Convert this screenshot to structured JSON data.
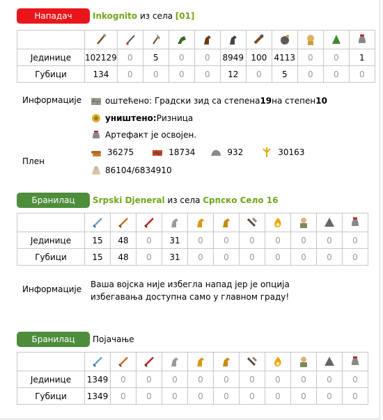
{
  "attacker": {
    "role": "Нападач",
    "player": "Inkognito",
    "from_text": "из села",
    "village": "[01]",
    "units_label": "Јединице",
    "losses_label": "Губици",
    "units": [
      "102129",
      "0",
      "5",
      "0",
      "0",
      "8949",
      "100",
      "4113",
      "0",
      "0",
      "1"
    ],
    "losses": [
      "134",
      "0",
      "0",
      "0",
      "0",
      "12",
      "0",
      "5",
      "0",
      "0",
      "0"
    ],
    "icons": [
      "spear-fighter-icon",
      "swordsman-icon",
      "axeman-icon",
      "scout-icon",
      "light-cavalry-icon",
      "heavy-cavalry-icon",
      "ram-icon",
      "catapult-icon",
      "knight-icon",
      "nobleman-icon",
      "militia-icon"
    ]
  },
  "info": {
    "label": "Информације",
    "line1_prefix": "оштећено: Градски зид са степена ",
    "line1_from": "19",
    "line1_mid": " на степен ",
    "line1_to": "10",
    "line2_bold": "уништено:",
    "line2_rest": " Ризница",
    "line3": "Артефакт је освојен.",
    "icons": [
      "wall-icon",
      "treasury-icon",
      "artifact-icon"
    ]
  },
  "loot": {
    "label": "Плен",
    "wood": "36275",
    "clay": "18734",
    "iron": "932",
    "crop": "30163",
    "carry": "86104/6834910"
  },
  "defender1": {
    "role": "Бранилац",
    "player": "Srpski Djeneral",
    "from_text": "из села",
    "village": "Српско Село 16",
    "units_label": "Јединице",
    "losses_label": "Губици",
    "units": [
      "15",
      "48",
      "0",
      "31",
      "0",
      "0",
      "0",
      "0",
      "0",
      "0",
      "0"
    ],
    "losses": [
      "15",
      "48",
      "0",
      "31",
      "0",
      "0",
      "0",
      "0",
      "0",
      "0",
      "0"
    ],
    "info_label": "Информације",
    "info_text": "Ваша војска није избегла напад јер је опција избегавања доступна само у главном граду!"
  },
  "defender2": {
    "role": "Бранилац",
    "title": "Појачање",
    "units_label": "Јединице",
    "losses_label": "Губици",
    "units": [
      "1349",
      "0",
      "0",
      "0",
      "0",
      "0",
      "0",
      "0",
      "0",
      "0",
      "0"
    ],
    "losses": [
      "1349",
      "0",
      "0",
      "0",
      "0",
      "0",
      "0",
      "0",
      "0",
      "0",
      "0"
    ]
  },
  "defender_icons": [
    "sword-icon",
    "spear-icon",
    "blade-icon",
    "horse-icon",
    "gold-horse-icon",
    "gold-horse-icon",
    "ram-head-icon",
    "fire-icon",
    "settler-icon",
    "wizard-hat-icon",
    "helmet-icon"
  ],
  "colors": {
    "attacker_badge": "#e8161b",
    "defender_badge": "#4d8d3c",
    "link_green": "#71a61a",
    "zero_gray": "#9a9a9a"
  }
}
